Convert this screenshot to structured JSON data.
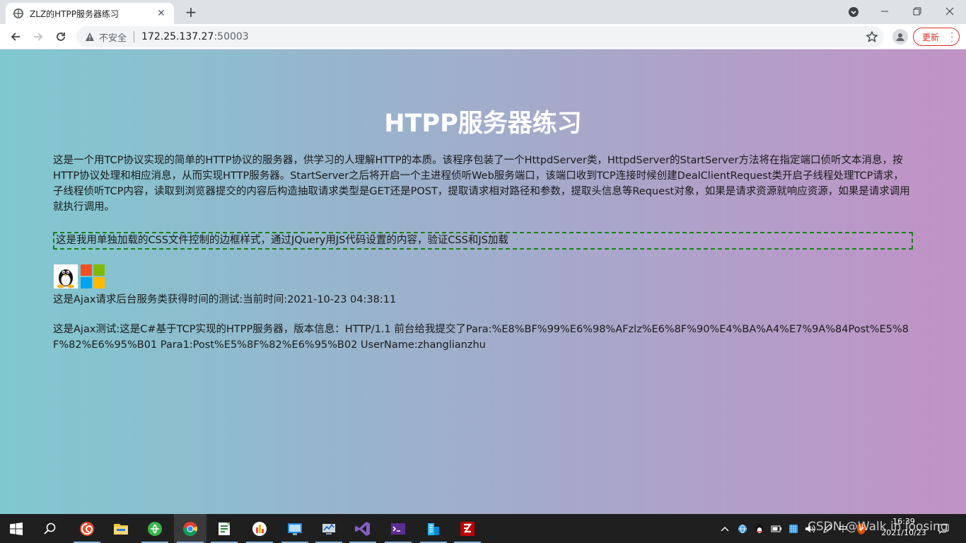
{
  "browser": {
    "tab_title": "ZLZ的HTPP服务器练习",
    "tab_close": "✕",
    "new_tab": "+",
    "security_label": "不安全",
    "url_host": "172.25.137.27",
    "url_port": ":50003",
    "update_label": "更新"
  },
  "page": {
    "heading": "HTPP服务器练习",
    "intro": "这是一个用TCP协议实现的简单的HTTP协议的服务器，供学习的人理解HTTP的本质。该程序包装了一个HttpdServer类，HttpdServer的StartServer方法将在指定端口侦听文本消息，按HTTP协议处理和相应消息，从而实现HTTP服务器。StartServer之后将开启一个主进程侦听Web服务端口，该端口收到TCP连接时候创建DealClientRequest类开启子线程处理TCP请求，子线程侦听TCP内容，读取到浏览器提交的内容后构造抽取请求类型是GET还是POST，提取请求相对路径和参数，提取头信息等Request对象，如果是请求资源就响应资源，如果是请求调用就执行调用。",
    "css_box_text": "这是我用单独加载的CSS文件控制的边框样式，通过JQuery用JS代码设置的内容，验证CSS和JS加载",
    "ajax_time": "这是Ajax请求后台服务类获得时间的测试:当前时间:2021-10-23 04:38:11",
    "ajax_test": "这是Ajax测试:这是C#基于TCP实现的HTPP服务器，版本信息：HTTP/1.1 前台给我提交了Para:%E8%BF%99%E6%98%AFzlz%E6%8F%90%E4%BA%A4%E7%9A%84Post%E5%8F%82%E6%95%B01 Para1:Post%E5%8F%82%E6%95%B02 UserName:zhanglianzhu",
    "icons": [
      "linux-penguin-icon",
      "windows-logo-icon"
    ]
  },
  "taskbar": {
    "clock_time": "16:39",
    "clock_date": "2021/10/23",
    "ime_label": "中",
    "watermark": "CSDN @Walk in loosing"
  },
  "colors": {
    "gradient_left": "#80c8d0",
    "gradient_right": "#c192c6",
    "dashed_border": "#1b7f1b",
    "update_red": "#d93025"
  }
}
